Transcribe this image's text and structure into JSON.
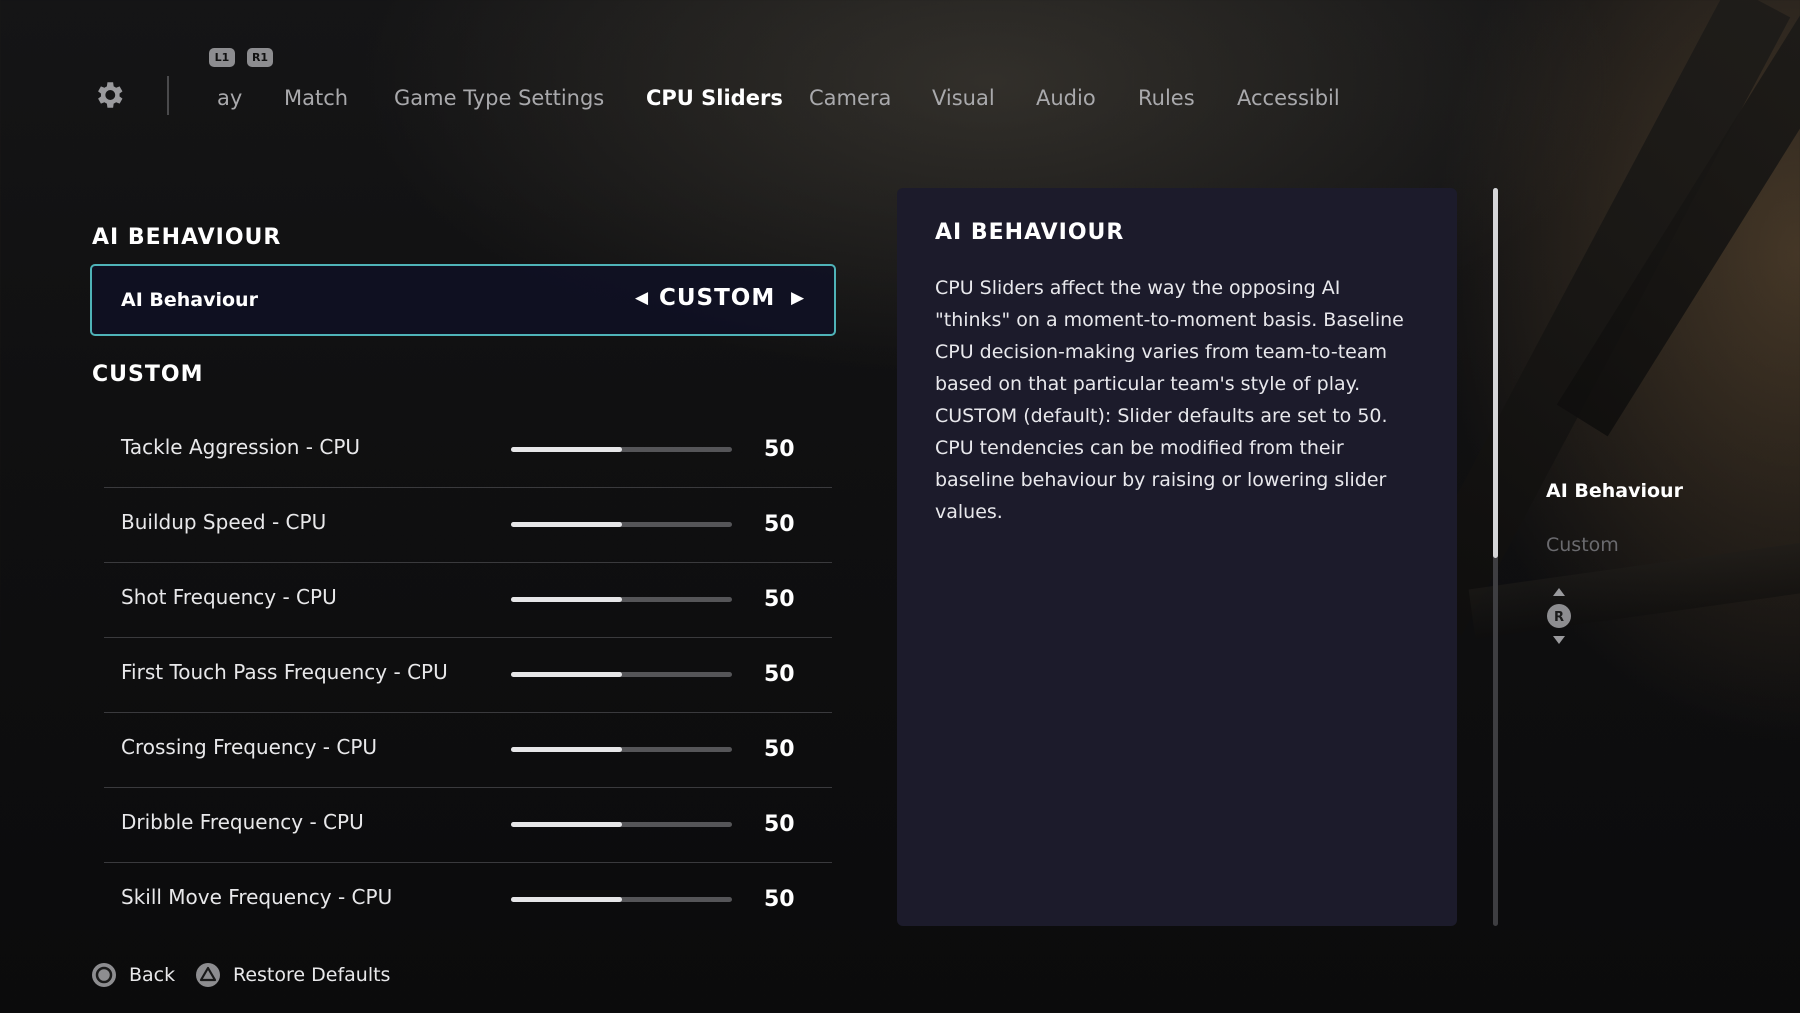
{
  "header": {
    "shoulder_left": "L1",
    "shoulder_right": "R1",
    "tabs": [
      {
        "label": "ay",
        "active": false
      },
      {
        "label": "Match",
        "active": false
      },
      {
        "label": "Game Type Settings",
        "active": false
      },
      {
        "label": "CPU Sliders",
        "active": true
      },
      {
        "label": "Camera",
        "active": false
      },
      {
        "label": "Visual",
        "active": false
      },
      {
        "label": "Audio",
        "active": false
      },
      {
        "label": "Rules",
        "active": false
      },
      {
        "label": "Accessibil",
        "active": false
      }
    ]
  },
  "left": {
    "section_title": "AI BEHAVIOUR",
    "ai_row": {
      "label": "AI Behaviour",
      "value": "CUSTOM"
    },
    "custom_title": "CUSTOM",
    "sliders": [
      {
        "label": "Tackle Aggression - CPU",
        "value": "50",
        "level": 0.5
      },
      {
        "label": "Buildup Speed - CPU",
        "value": "50",
        "level": 0.5
      },
      {
        "label": "Shot Frequency - CPU",
        "value": "50",
        "level": 0.5
      },
      {
        "label": "First Touch Pass Frequency - CPU",
        "value": "50",
        "level": 0.5
      },
      {
        "label": "Crossing Frequency - CPU",
        "value": "50",
        "level": 0.5
      },
      {
        "label": "Dribble Frequency - CPU",
        "value": "50",
        "level": 0.5
      },
      {
        "label": "Skill Move Frequency - CPU",
        "value": "50",
        "level": 0.5
      }
    ]
  },
  "info": {
    "title": "AI BEHAVIOUR",
    "body": "CPU Sliders affect the way the opposing AI \"thinks\" on a moment-to-moment basis. Baseline CPU decision-making varies from team-to-team based on that particular team's style of play. CUSTOM (default): Slider defaults are set to 50. CPU tendencies can be modified from their baseline behaviour by raising or lowering slider values."
  },
  "side_nav": {
    "items": [
      {
        "label": "AI Behaviour",
        "active": true
      },
      {
        "label": "Custom",
        "active": false
      }
    ],
    "stick_label": "R"
  },
  "footer": {
    "back_label": "Back",
    "restore_label": "Restore Defaults"
  },
  "colors": {
    "accent_border": "#4fb3b8",
    "panel_bg": "#1c1b2b"
  }
}
